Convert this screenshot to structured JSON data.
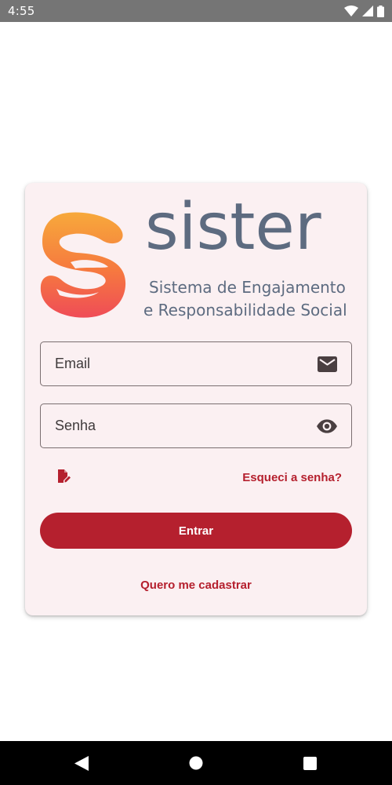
{
  "status_bar": {
    "time": "4:55",
    "icons": [
      "wifi-icon",
      "signal-icon",
      "battery-icon"
    ]
  },
  "logo": {
    "wordmark": "sister",
    "tagline_line1": "Sistema de Engajamento",
    "tagline_line2": "e Responsabilidade Social"
  },
  "login_form": {
    "email_placeholder": "Email",
    "email_value": "",
    "email_icon": "mail-icon",
    "password_placeholder": "Senha",
    "password_value": "",
    "password_icon": "eye-icon",
    "edit_icon": "edit-document-icon",
    "forgot_password_label": "Esqueci a senha?",
    "submit_label": "Entrar",
    "register_label": "Quero me cadastrar"
  },
  "nav_bar": {
    "buttons": [
      "back-icon",
      "home-icon",
      "recent-apps-icon"
    ]
  },
  "colors": {
    "status_bar": "#757575",
    "card_background": "#fbf0f2",
    "accent": "#b5202e",
    "logo_text": "#5d6b80",
    "logo_gradient_top": "#f7a93b",
    "logo_gradient_bottom": "#ef4c57"
  }
}
